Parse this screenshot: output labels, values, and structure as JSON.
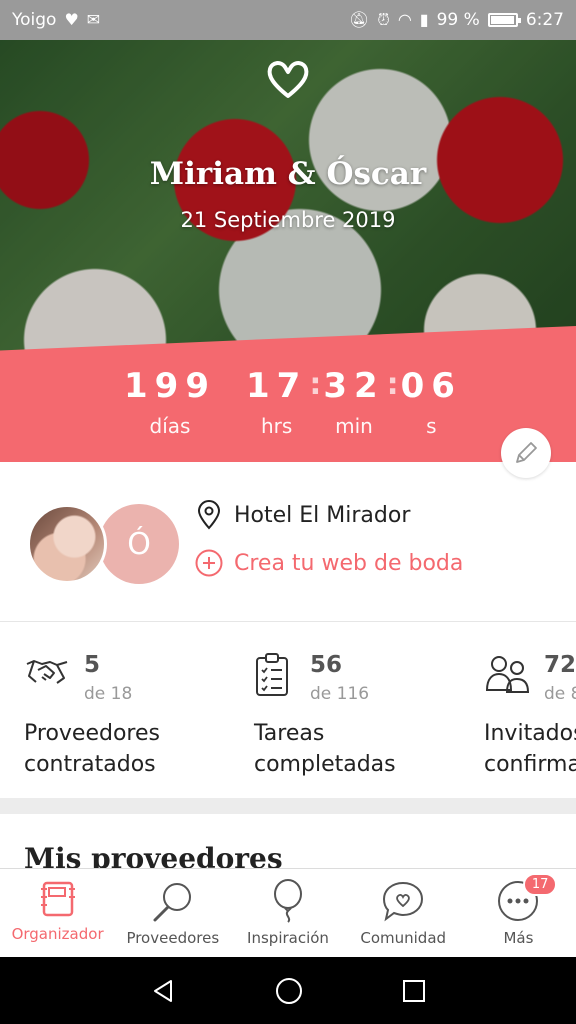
{
  "status_bar": {
    "carrier": "Yoigo",
    "battery": "99 %",
    "time": "6:27"
  },
  "hero": {
    "couple": "Miriam & Óscar",
    "date": "21 Septiembre 2019"
  },
  "countdown": {
    "days": "199",
    "days_label": "días",
    "hours": "17",
    "hours_label": "hrs",
    "minutes": "32",
    "minutes_label": "min",
    "seconds": "06",
    "seconds_label": "s"
  },
  "profile": {
    "avatar_letter": "Ó",
    "venue": "Hotel El Mirador",
    "create_web": "Crea tu web de boda"
  },
  "stats": [
    {
      "value": "5",
      "total": "de 18",
      "title_line1": "Proveedores",
      "title_line2": "contratados",
      "icon": "handshake-icon"
    },
    {
      "value": "56",
      "total": "de 116",
      "title_line1": "Tareas",
      "title_line2": "completadas",
      "icon": "checklist-icon"
    },
    {
      "value": "72",
      "total": "de 8",
      "title_line1": "Invitados",
      "title_line2": "confirma",
      "icon": "guests-icon"
    }
  ],
  "section": {
    "title": "Mis proveedores"
  },
  "nav": [
    {
      "label": "Organizador",
      "icon": "planner-icon",
      "active": true
    },
    {
      "label": "Proveedores",
      "icon": "search-icon",
      "active": false
    },
    {
      "label": "Inspiración",
      "icon": "balloon-icon",
      "active": false
    },
    {
      "label": "Comunidad",
      "icon": "chat-heart-icon",
      "active": false
    },
    {
      "label": "Más",
      "icon": "more-icon",
      "active": false,
      "badge": "17"
    }
  ],
  "colors": {
    "accent": "#f4696f",
    "avatar_bg": "#ebb3ae"
  }
}
